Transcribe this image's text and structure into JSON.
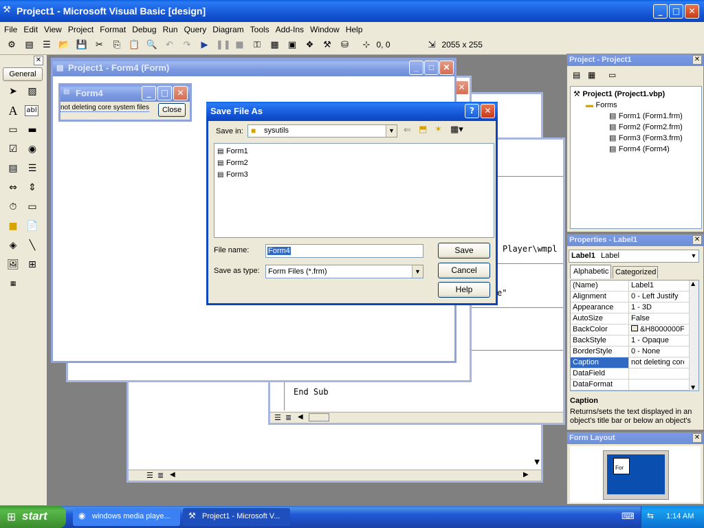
{
  "app": {
    "title": "Project1 - Microsoft Visual Basic [design]",
    "menu": [
      "File",
      "Edit",
      "View",
      "Project",
      "Format",
      "Debug",
      "Run",
      "Query",
      "Diagram",
      "Tools",
      "Add-Ins",
      "Window",
      "Help"
    ],
    "toolbar": {
      "position": "0, 0",
      "size": "2055 x 255"
    }
  },
  "toolbox": {
    "title": "General"
  },
  "form_designer": {
    "title": "Project1 - Form4 (Form)"
  },
  "form4": {
    "title": "Form4",
    "label": "not deleting core system files",
    "close_button": "Close"
  },
  "code": {
    "line1": "Player\\wmpl",
    "line2": "e\"",
    "line3": "End Sub"
  },
  "dialog": {
    "title": "Save File As",
    "help_glyph": "?",
    "save_in_label": "Save in:",
    "save_in_value": "sysutils",
    "files": [
      "Form1",
      "Form2",
      "Form3"
    ],
    "file_name_label": "File name:",
    "file_name_value": "Form4",
    "save_type_label": "Save as type:",
    "save_type_value": "Form Files (*.frm)",
    "save_button": "Save",
    "cancel_button": "Cancel",
    "help_button": "Help"
  },
  "project_explorer": {
    "title": "Project - Project1",
    "root": "Project1 (Project1.vbp)",
    "folder": "Forms",
    "items": [
      "Form1 (Form1.frm)",
      "Form2 (Form2.frm)",
      "Form3 (Form3.frm)",
      "Form4 (Form4)"
    ]
  },
  "properties": {
    "title": "Properties - Label1",
    "object": "Label1",
    "object_type": "Label",
    "tabs": [
      "Alphabetic",
      "Categorized"
    ],
    "rows": [
      {
        "k": "(Name)",
        "v": "Label1"
      },
      {
        "k": "Alignment",
        "v": "0 - Left Justify"
      },
      {
        "k": "Appearance",
        "v": "1 - 3D"
      },
      {
        "k": "AutoSize",
        "v": "False"
      },
      {
        "k": "BackColor",
        "v": "&H8000000F"
      },
      {
        "k": "BackStyle",
        "v": "1 - Opaque"
      },
      {
        "k": "BorderStyle",
        "v": "0 - None"
      },
      {
        "k": "Caption",
        "v": "not deleting core"
      },
      {
        "k": "DataField",
        "v": ""
      },
      {
        "k": "DataFormat",
        "v": ""
      }
    ],
    "desc_title": "Caption",
    "desc_text": "Returns/sets the text displayed in an object's title bar or below an object's"
  },
  "form_layout": {
    "title": "Form Layout",
    "thumb_label": "For"
  },
  "taskbar": {
    "start": "start",
    "items": [
      "windows media playe...",
      "Project1 - Microsoft V..."
    ],
    "clock": "1:14 AM"
  },
  "colors": {
    "xp_blue": "#0a5fe0",
    "desktop": "#3a6ea5",
    "taskbar": "#2157d7",
    "start_green": "#3c9a2f"
  }
}
